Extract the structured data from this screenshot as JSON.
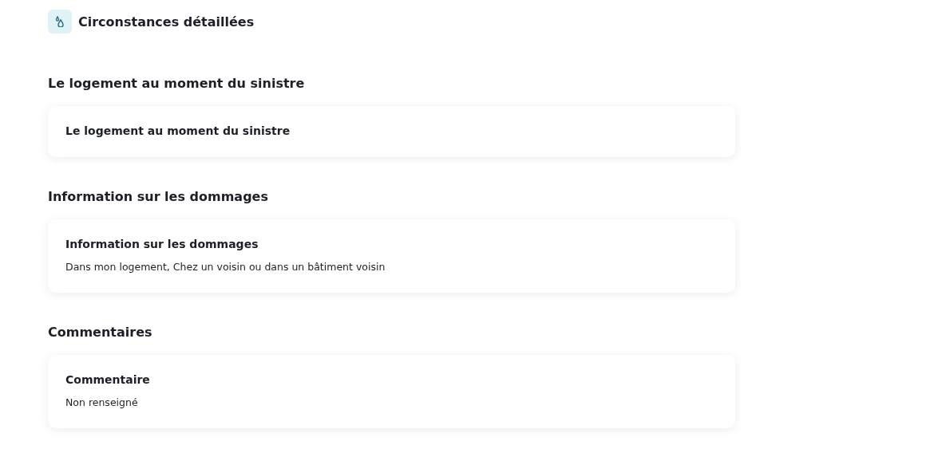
{
  "header": {
    "title": "Circonstances détaillées"
  },
  "sections": [
    {
      "heading": "Le logement au moment du sinistre",
      "card": {
        "title": "Le logement au moment du sinistre"
      }
    },
    {
      "heading": "Information sur les dommages",
      "card": {
        "title": "Information sur les dommages",
        "value": "Dans mon logement, Chez un voisin ou dans un bâtiment voisin"
      }
    },
    {
      "heading": "Commentaires",
      "card": {
        "title": "Commentaire",
        "value": "Non renseigné"
      }
    }
  ]
}
